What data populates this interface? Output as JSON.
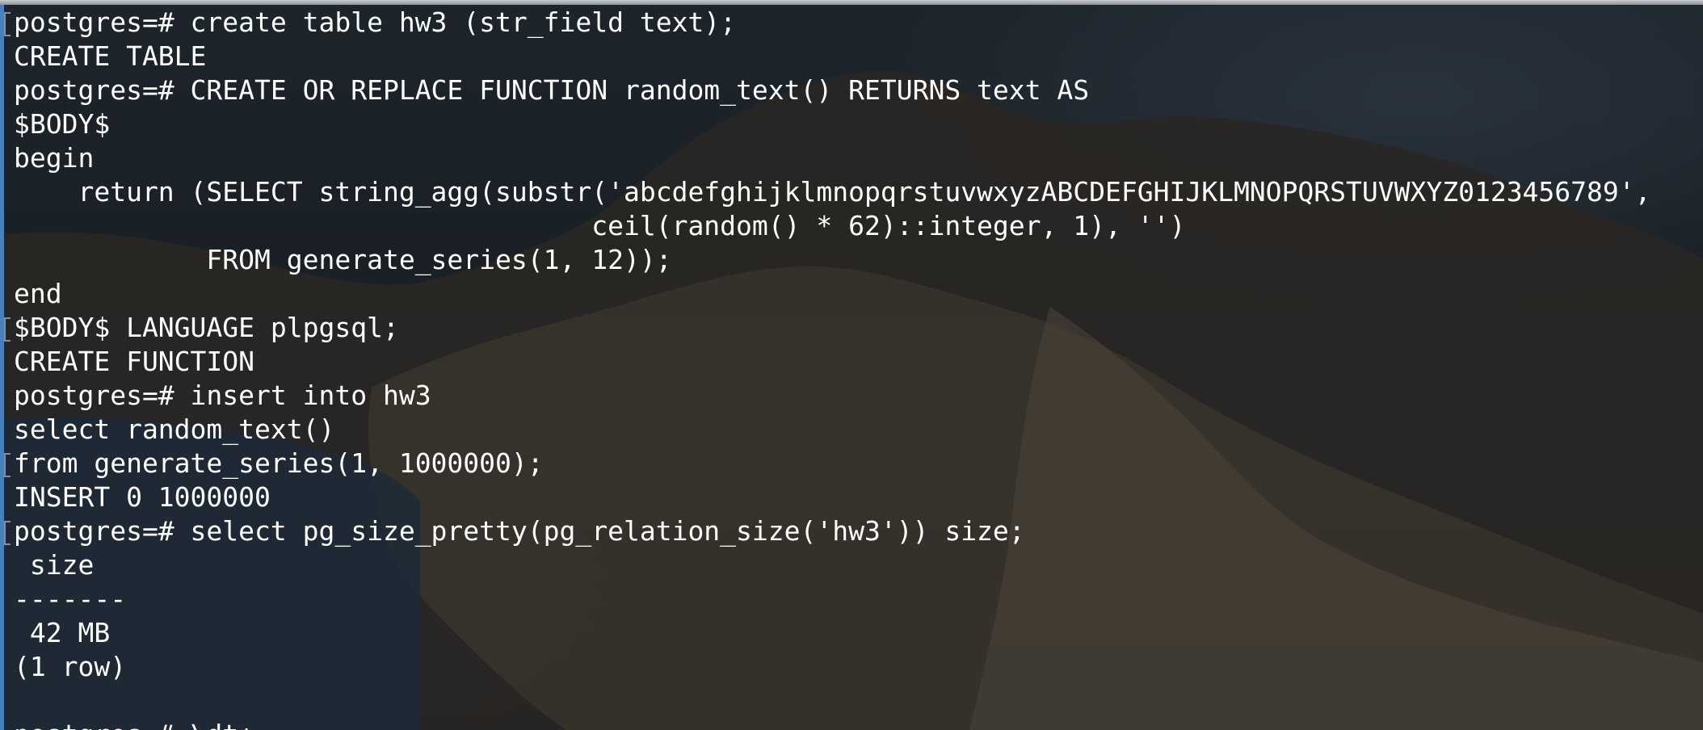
{
  "terminal": {
    "lines": [
      "postgres=# create table hw3 (str_field text);",
      "CREATE TABLE",
      "postgres=# CREATE OR REPLACE FUNCTION random_text() RETURNS text AS",
      "$BODY$",
      "begin",
      "    return (SELECT string_agg(substr('abcdefghijklmnopqrstuvwxyzABCDEFGHIJKLMNOPQRSTUVWXYZ0123456789',",
      "                                    ceil(random() * 62)::integer, 1), '')",
      "            FROM generate_series(1, 12));",
      "end",
      "$BODY$ LANGUAGE plpgsql;",
      "CREATE FUNCTION",
      "postgres=# insert into hw3",
      "select random_text()",
      "from generate_series(1, 1000000);",
      "INSERT 0 1000000",
      "postgres=# select pg_size_pretty(pg_relation_size('hw3')) size;",
      " size",
      "-------",
      " 42 MB",
      "(1 row)",
      "",
      "postgres=# \\dt+"
    ]
  },
  "colors": {
    "text": "#ffffff",
    "background": "#15181b",
    "left_edge": "#4c7fb8"
  }
}
